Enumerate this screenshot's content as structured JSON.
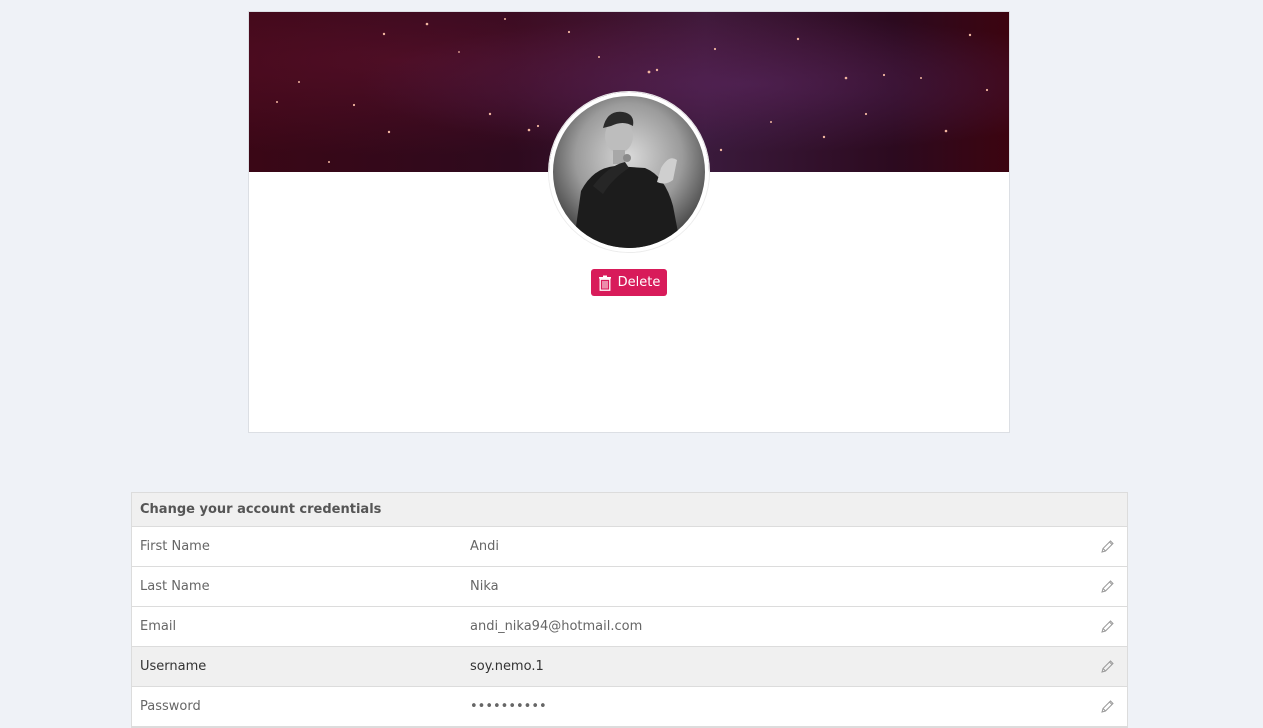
{
  "profile": {
    "delete_label": "Delete",
    "avatar_alt": "profile photo"
  },
  "credentials": {
    "title": "Change your account credentials",
    "rows": [
      {
        "label": "First Name",
        "value": "Andi"
      },
      {
        "label": "Last Name",
        "value": "Nika"
      },
      {
        "label": "Email",
        "value": "andi_nika94@hotmail.com"
      },
      {
        "label": "Username",
        "value": "soy.nemo.1"
      },
      {
        "label": "Password",
        "value": "••••••••••"
      }
    ]
  },
  "colors": {
    "background": "#eff2f7",
    "delete_button": "#d81b5a",
    "cover_dark": "#2e0a1e"
  },
  "icons": {
    "edit": "pencil-icon",
    "delete": "trash-icon"
  }
}
